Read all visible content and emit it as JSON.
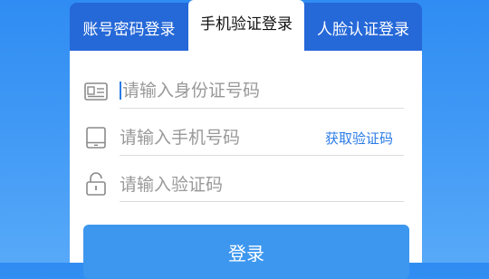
{
  "tabs": [
    {
      "label": "账号密码登录",
      "active": false,
      "icon": ""
    },
    {
      "label": "手机验证登录",
      "active": true,
      "icon": ""
    },
    {
      "label": "人脸认证登录",
      "active": false,
      "icon": ""
    }
  ],
  "form": {
    "id_field": {
      "placeholder": "请输入身份证号码",
      "value": "",
      "icon": "id-card-icon"
    },
    "phone_field": {
      "placeholder": "请输入手机号码",
      "value": "",
      "icon": "tablet-icon"
    },
    "code_field": {
      "placeholder": "请输入验证码",
      "value": "",
      "icon": "lock-icon"
    },
    "get_code_label": "获取验证码",
    "login_label": "登录"
  },
  "colors": {
    "background": "#3a93f4",
    "tab_inactive": "#2568d8",
    "accent": "#2a7be6",
    "button": "#3d97ef"
  }
}
